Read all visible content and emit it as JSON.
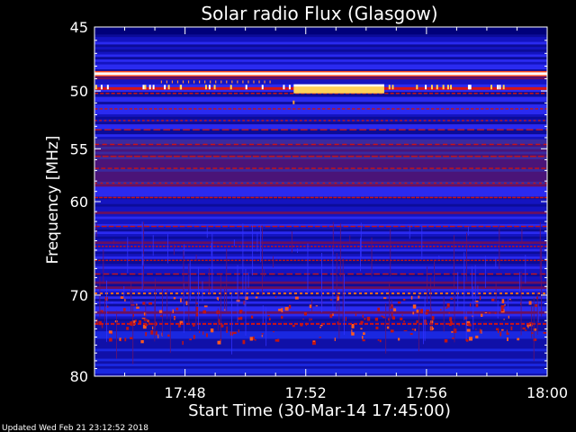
{
  "chart_data": {
    "type": "heatmap",
    "title": "Solar radio Flux (Glasgow)",
    "xlabel": "Start Time (30-Mar-14 17:45:00)",
    "ylabel": "Frequency [MHz]",
    "x_ticks": [
      "17:48",
      "17:52",
      "17:56",
      "18:00"
    ],
    "x_tick_minutes": [
      3,
      7,
      11,
      15
    ],
    "xlim_minutes_after_start": [
      0,
      15
    ],
    "y_ticks": [
      45,
      50,
      55,
      60,
      70,
      80
    ],
    "ylim": [
      45,
      80
    ],
    "y_scale": "log",
    "colormap": [
      "#00009a",
      "#1a1ad8",
      "#3a3aff",
      "#7a1060",
      "#c81414",
      "#ff5a1e",
      "#ffd25a",
      "#ffffff"
    ],
    "bright_bands_mhz": [
      48.6,
      49.8,
      72
    ],
    "burst": {
      "start_minute": 6.6,
      "end_minute": 9.6,
      "freq_mhz": [
        49.6,
        50.2
      ]
    }
  },
  "footer": {
    "updated": "Updated Wed Feb 21 23:12:52 2018"
  },
  "colors": {
    "background": "#000000",
    "axis": "#ffffff",
    "text": "#ffffff"
  }
}
